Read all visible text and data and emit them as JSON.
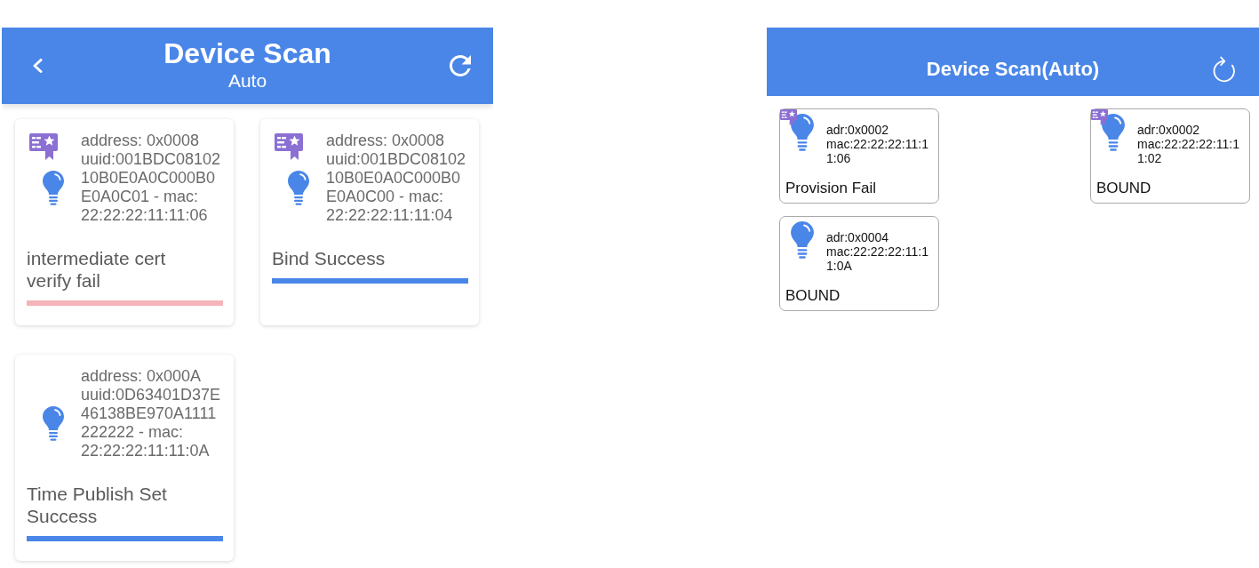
{
  "screens": [
    {
      "kind": "detailed",
      "header": {
        "title": "Device Scan",
        "subtitle": "Auto"
      },
      "devices": [
        {
          "certified": true,
          "info_lines": [
            "address: 0x0008",
            "uuid:001BDC08102",
            "10B0E0A0C000B0",
            "E0A0C01 - mac:",
            "22:22:22:11:11:06"
          ],
          "status": "intermediate cert verify fail",
          "color": "#f4b4b9"
        },
        {
          "certified": true,
          "info_lines": [
            "address: 0x0008",
            "uuid:001BDC08102",
            "10B0E0A0C000B0",
            "E0A0C00 - mac:",
            "22:22:22:11:11:04"
          ],
          "status": "Bind Success",
          "color": "#4a86e8"
        },
        {
          "certified": false,
          "info_lines": [
            "address: 0x000A",
            "uuid:0D63401D37E",
            "46138BE970A1111",
            "222222 - mac:",
            "22:22:22:11:11:0A"
          ],
          "status": "Time Publish Set Success",
          "color": "#4a86e8"
        }
      ]
    },
    {
      "kind": "compact",
      "header": {
        "title": "Device Scan(Auto)"
      },
      "devices": [
        {
          "certified": true,
          "info_lines": [
            "adr:0x0002",
            "mac:22:22:22:11:1",
            "1:06"
          ],
          "status": "Provision Fail"
        },
        {
          "certified": true,
          "info_lines": [
            "adr:0x0002",
            "mac:22:22:22:11:1",
            "1:02"
          ],
          "status": "BOUND"
        },
        {
          "certified": false,
          "info_lines": [
            "adr:0x0004",
            "mac:22:22:22:11:1",
            "1:0A"
          ],
          "status": "BOUND"
        }
      ]
    }
  ]
}
